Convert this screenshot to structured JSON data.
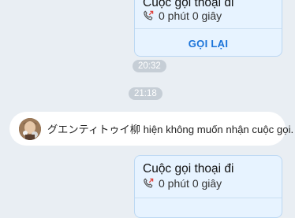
{
  "top_card": {
    "title": "Cuộc gọi thoại đi",
    "duration": "0 phút 0 giây",
    "action_label": "GỌI LẠI"
  },
  "timestamps": [
    "20:32",
    "21:18"
  ],
  "notice": {
    "name": "グエンティトゥイ柳",
    "message": " hiện không muốn nhận cuộc gọi."
  },
  "bottom_card": {
    "title": "Cuộc gọi thoại đi",
    "duration": "0 phút 0 giây"
  },
  "colors": {
    "background": "#e9eef3",
    "card_fill": "#e7f3ff",
    "accent": "#1a73d9",
    "outgoing_arrow": "#e0413b"
  },
  "icons": [
    "outgoing-call-icon",
    "avatar"
  ]
}
